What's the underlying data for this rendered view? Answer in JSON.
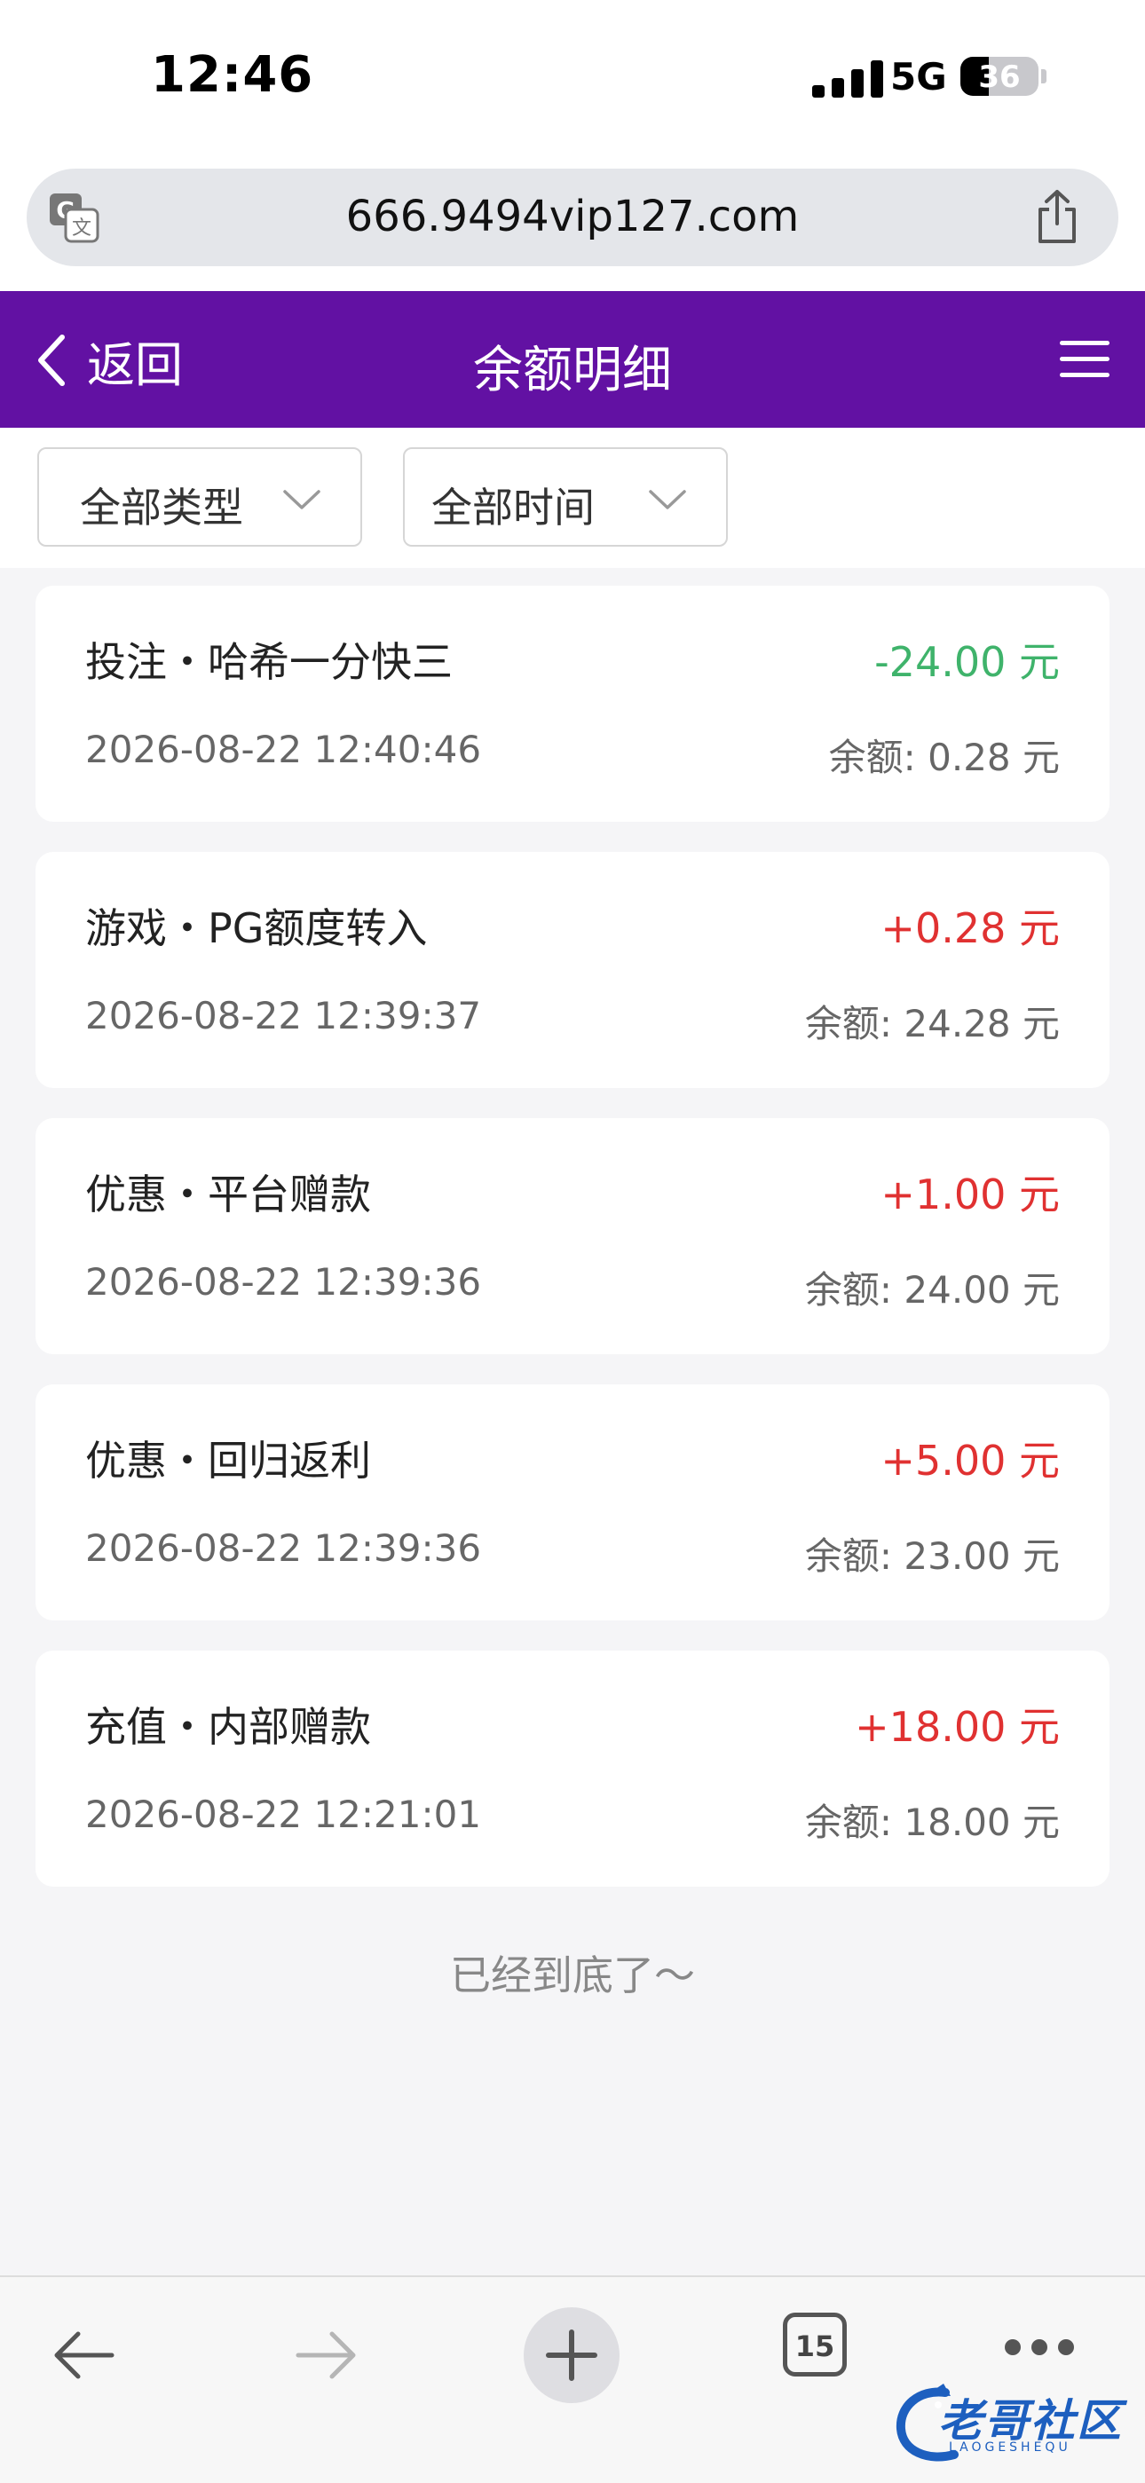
{
  "status_bar": {
    "time": "12:46",
    "network": "5G",
    "battery_pct": "36",
    "battery_level": 0.36
  },
  "browser": {
    "url": "666.9494vip127.com"
  },
  "header": {
    "back_label": "返回",
    "title": "余额明细"
  },
  "filters": {
    "type_label": "全部类型",
    "time_label": "全部时间"
  },
  "records": [
    {
      "title": "投注・哈希一分快三",
      "amount": "-24.00 元",
      "sign": "negative",
      "time": "2026-08-22 12:40:46",
      "balance": "余额: 0.28 元"
    },
    {
      "title": "游戏・PG额度转入",
      "amount": "+0.28 元",
      "sign": "positive",
      "time": "2026-08-22 12:39:37",
      "balance": "余额: 24.28 元"
    },
    {
      "title": "优惠・平台赠款",
      "amount": "+1.00 元",
      "sign": "positive",
      "time": "2026-08-22 12:39:36",
      "balance": "余额: 24.00 元"
    },
    {
      "title": "优惠・回归返利",
      "amount": "+5.00 元",
      "sign": "positive",
      "time": "2026-08-22 12:39:36",
      "balance": "余额: 23.00 元"
    },
    {
      "title": "充值・内部赠款",
      "amount": "+18.00 元",
      "sign": "positive",
      "time": "2026-08-22 12:21:01",
      "balance": "余额: 18.00 元"
    }
  ],
  "end_note": "已经到底了～",
  "toolbar": {
    "tab_count": "15"
  },
  "watermark": {
    "text": "老哥社区",
    "sub": "LAOGESHEQU"
  },
  "colors": {
    "header_bg": "#6211a3",
    "positive": "#e03131",
    "negative": "#3fb36b"
  },
  "icons": [
    "translate-icon",
    "share-icon",
    "chevron-left-icon",
    "menu-icon",
    "chevron-down-icon",
    "arrow-left-icon",
    "arrow-right-icon",
    "plus-icon",
    "tabs-icon",
    "more-icon"
  ]
}
